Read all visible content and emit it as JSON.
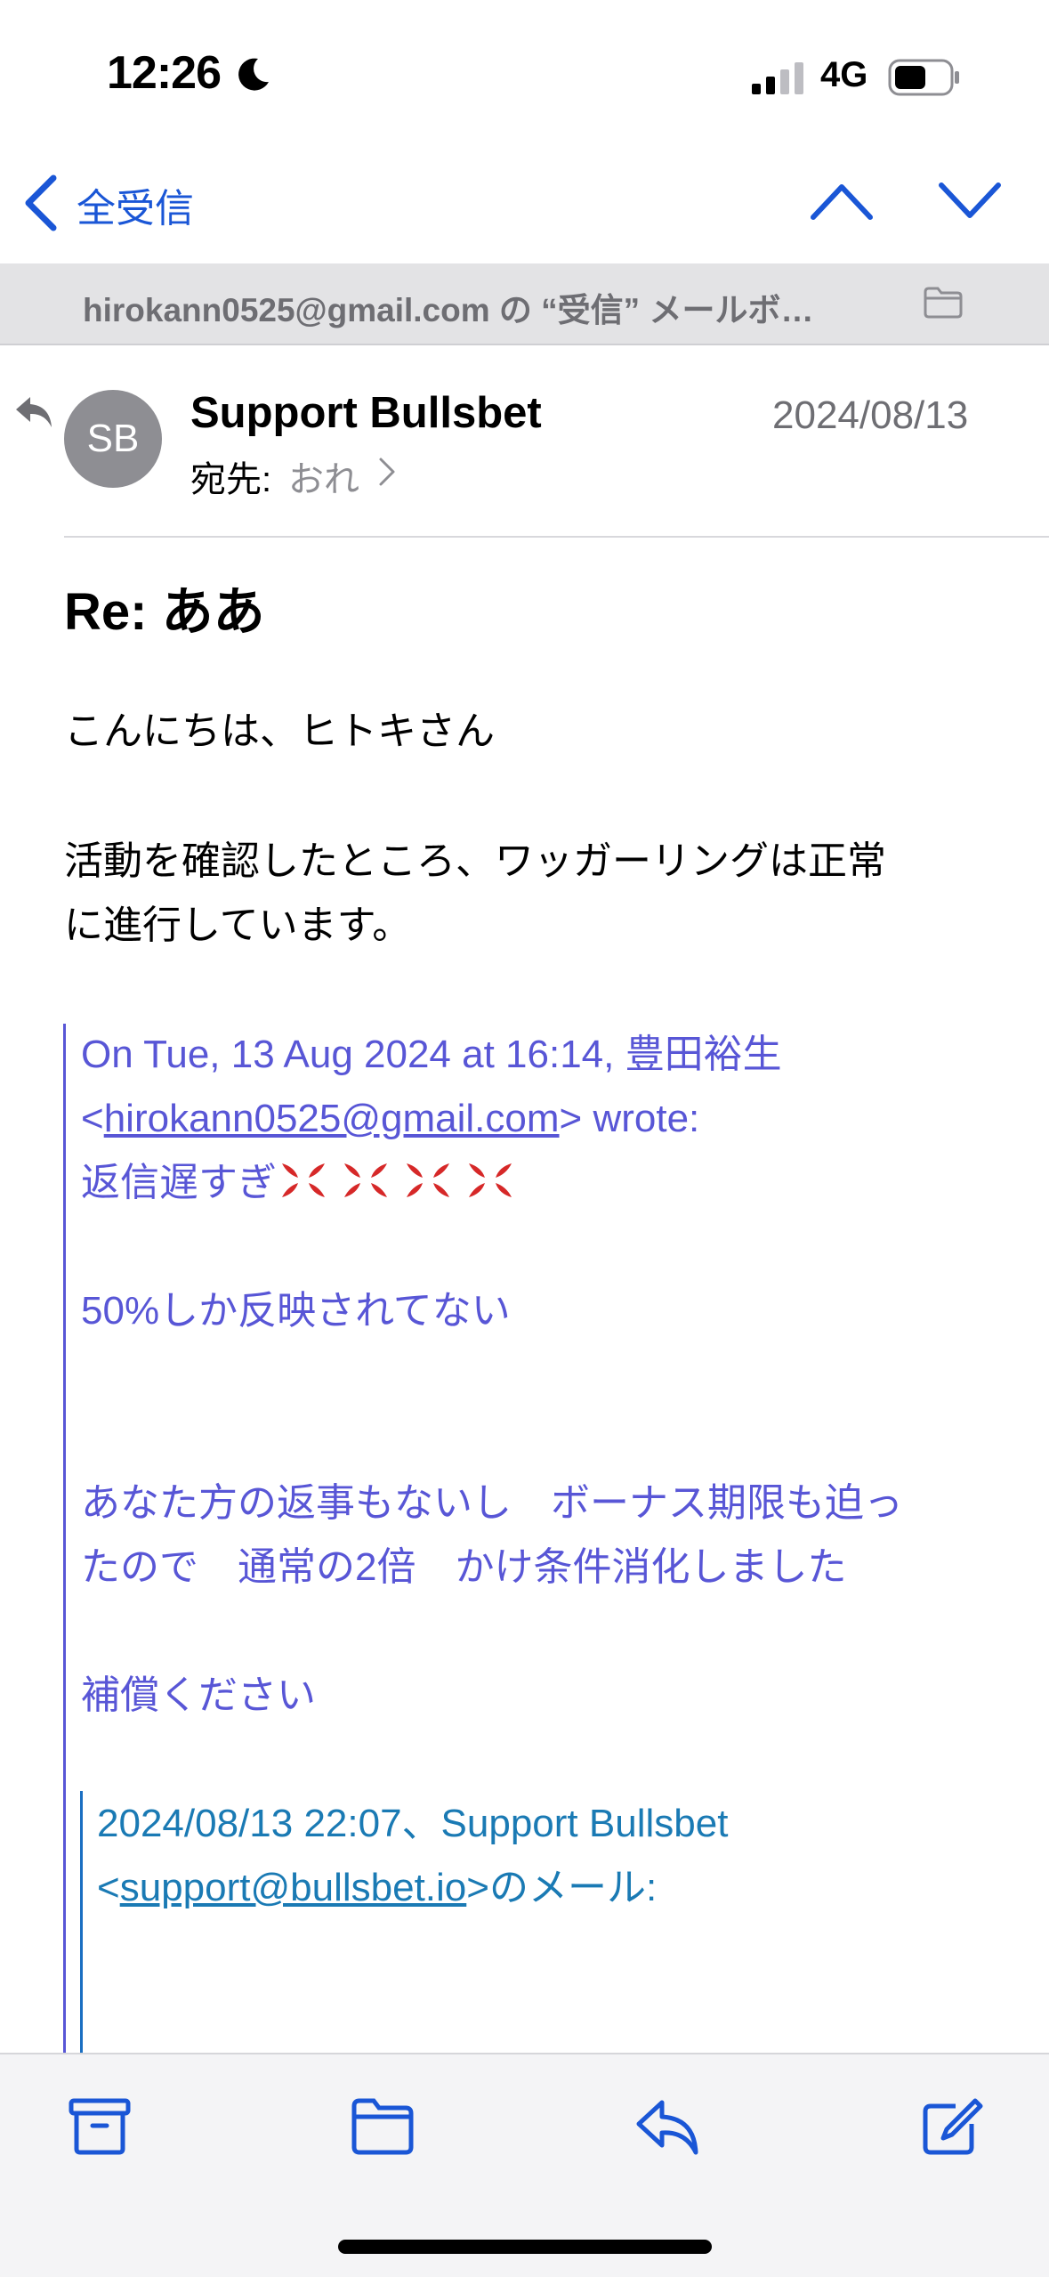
{
  "status_bar": {
    "time": "12:26",
    "network": "4G"
  },
  "nav": {
    "back_label": "全受信"
  },
  "mailbox_bar": {
    "text": "hirokann0525@gmail.com の “受信” メールボ…"
  },
  "header": {
    "avatar_initials": "SB",
    "sender": "Support Bullsbet",
    "date": "2024/08/13",
    "to_label": "宛先:",
    "to_name": "おれ"
  },
  "body": {
    "subject": "Re: ああ",
    "greeting": "こんにちは、ヒトキさん",
    "line1": "活動を確認したところ、ワッガーリングは正常",
    "line2": "に進行しています。"
  },
  "quote1": {
    "header_line": "On Tue, 13 Aug 2024 at 16:14, 豊田裕生",
    "email_open": "<",
    "email": "hirokann0525@gmail.com",
    "email_close": "> wrote:",
    "line_late": "返信遅すぎ",
    "line_50": "50%しか反映されてない",
    "line_a": "あなた方の返事もないし　ボーナス期限も迫っ",
    "line_b": "たので　通常の2倍　かけ条件消化しました",
    "line_comp": "補償ください"
  },
  "quote2": {
    "header_line": "2024/08/13 22:07、Support Bullsbet",
    "email_open": "<",
    "email": "support@bullsbet.io",
    "email_close": ">のメール:"
  },
  "colors": {
    "accent": "#1a56d6",
    "quote1": "#5856d6",
    "quote2": "#1a7ab4"
  },
  "icons": [
    "moon-icon",
    "signal-icon",
    "battery-icon",
    "chevron-left-icon",
    "chevron-up-icon",
    "chevron-down-icon",
    "folder-icon",
    "reply-indicator-icon",
    "anger-symbol-icon",
    "archive-icon",
    "move-folder-icon",
    "reply-icon",
    "compose-icon"
  ]
}
